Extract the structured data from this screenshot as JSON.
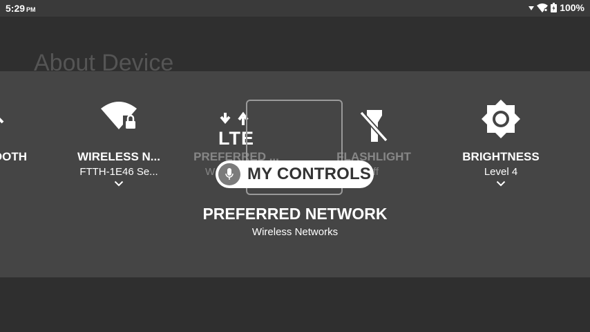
{
  "status_bar": {
    "time": "5:29",
    "ampm": "PM",
    "battery": "100%",
    "wifi_icon": "wifi-icon",
    "battery_icon": "battery-icon",
    "signal_icon": "signal-icon"
  },
  "background": {
    "title": "About Device"
  },
  "tiles": [
    {
      "label": "OOTH",
      "sub": "",
      "icon": "bluetooth-icon"
    },
    {
      "label": "WIRELESS N...",
      "sub": "FTTH-1E46 Se...",
      "icon": "wifi-lock-icon"
    },
    {
      "label": "PREFERRED ...",
      "sub": "W",
      "icon": "lte-icon",
      "badge": "LTE"
    },
    {
      "label": "FLASHLIGHT",
      "sub": "ff",
      "icon": "flashlight-off-icon"
    },
    {
      "label": "BRIGHTNESS",
      "sub": "Level 4",
      "icon": "brightness-icon"
    }
  ],
  "voice_prompt": {
    "label": "MY CONTROLS",
    "icon": "mic-icon"
  },
  "detail": {
    "title": "PREFERRED NETWORK",
    "subtitle": "Wireless Networks"
  },
  "colors": {
    "background": "#2f2f2f",
    "panel": "#454545",
    "status_bar": "#3a3a3a",
    "pill": "#ffffff"
  }
}
